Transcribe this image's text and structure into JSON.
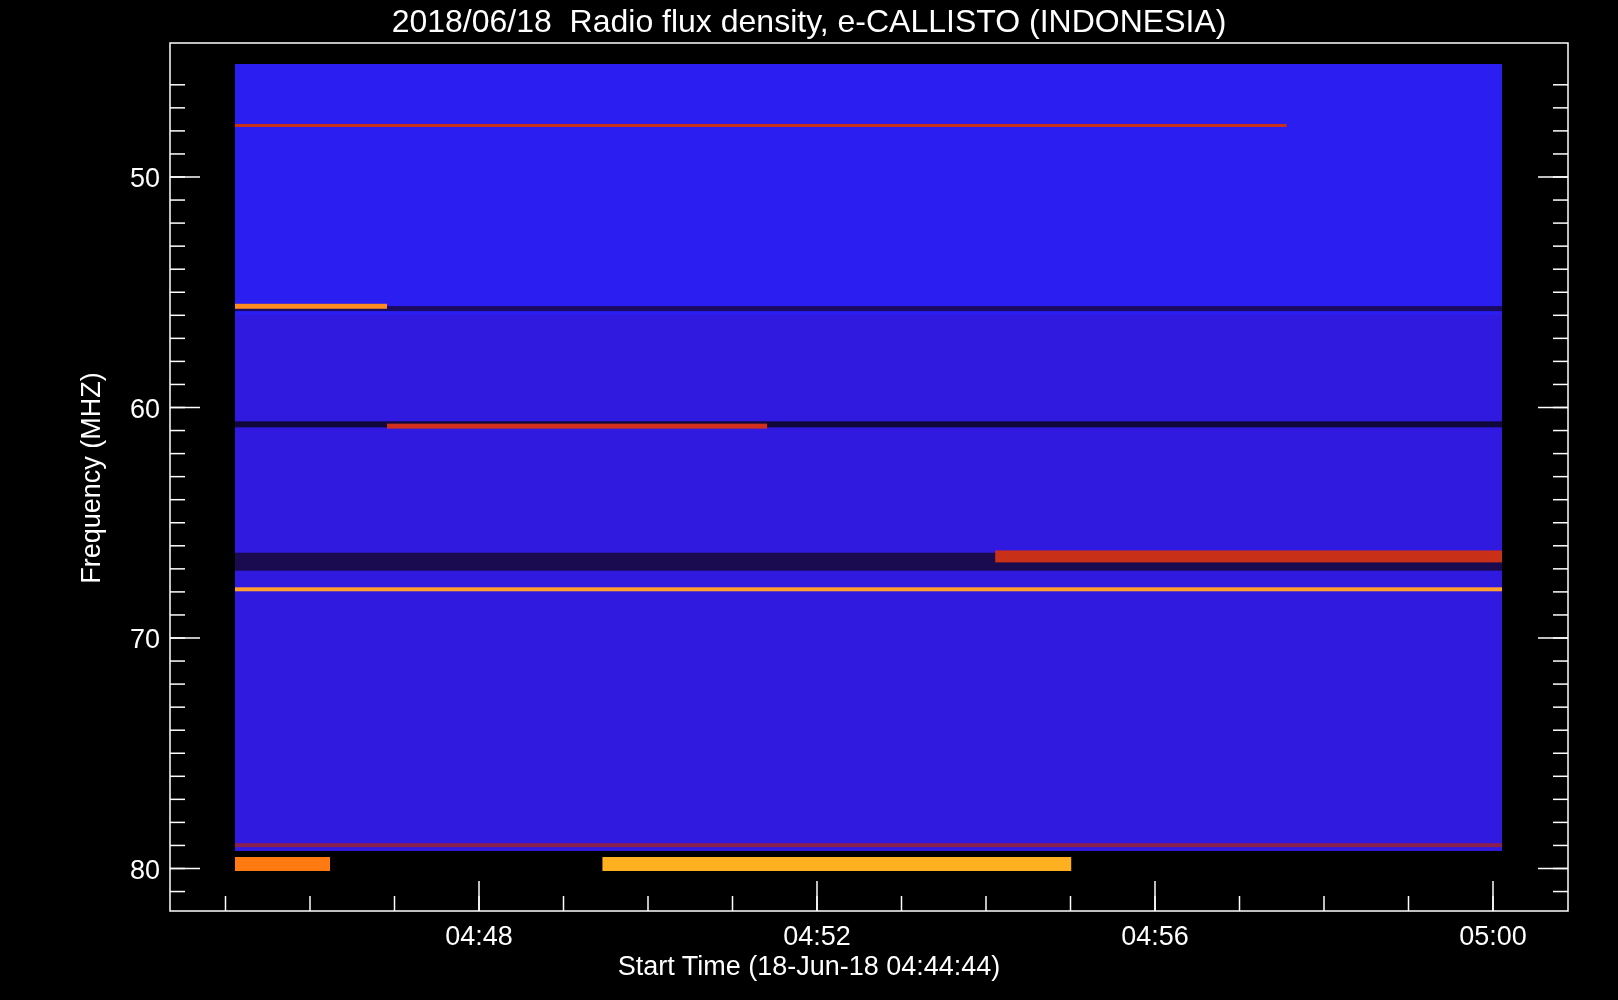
{
  "title": "2018/06/18  Radio flux density, e-CALLISTO (INDONESIA)",
  "y_axis": {
    "label": "Frequency (MHZ)",
    "ticks": [
      "50",
      "60",
      "70",
      "80"
    ]
  },
  "x_axis": {
    "label": "Start Time (18-Jun-18 04:44:44)",
    "ticks": [
      "04:48",
      "04:52",
      "04:56",
      "05:00"
    ]
  }
}
